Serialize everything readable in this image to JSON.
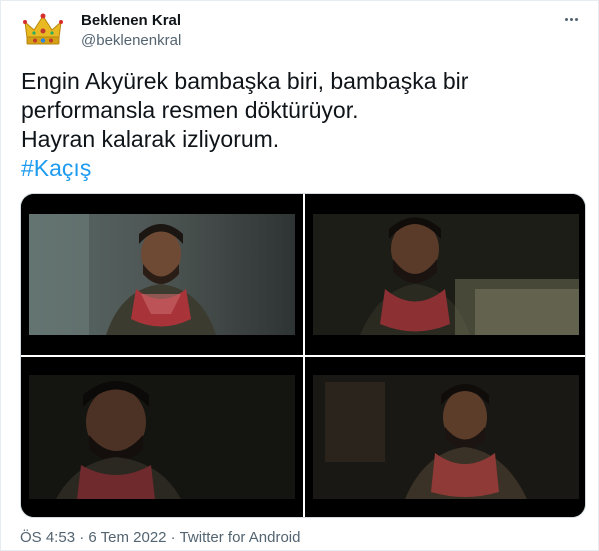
{
  "author": {
    "display_name": "Beklenen Kral",
    "handle": "@beklenenkral",
    "avatar_icon": "crown-icon"
  },
  "tweet": {
    "lines": [
      "Engin Akyürek bambaşka biri, bambaşka bir",
      "performansla resmen döktürüyor.",
      "Hayran kalarak izliyorum."
    ],
    "hashtag": "#Kaçış"
  },
  "media": {
    "images": [
      {
        "label": "still-1"
      },
      {
        "label": "still-2"
      },
      {
        "label": "still-3"
      },
      {
        "label": "still-4"
      }
    ]
  },
  "meta": {
    "time": "ÖS 4:53",
    "separator1": " · ",
    "date": "6 Tem 2022",
    "separator2": " · ",
    "source": "Twitter for Android"
  },
  "colors": {
    "link": "#1d9bf0",
    "secondary_text": "#536471",
    "primary_text": "#0f1419"
  }
}
